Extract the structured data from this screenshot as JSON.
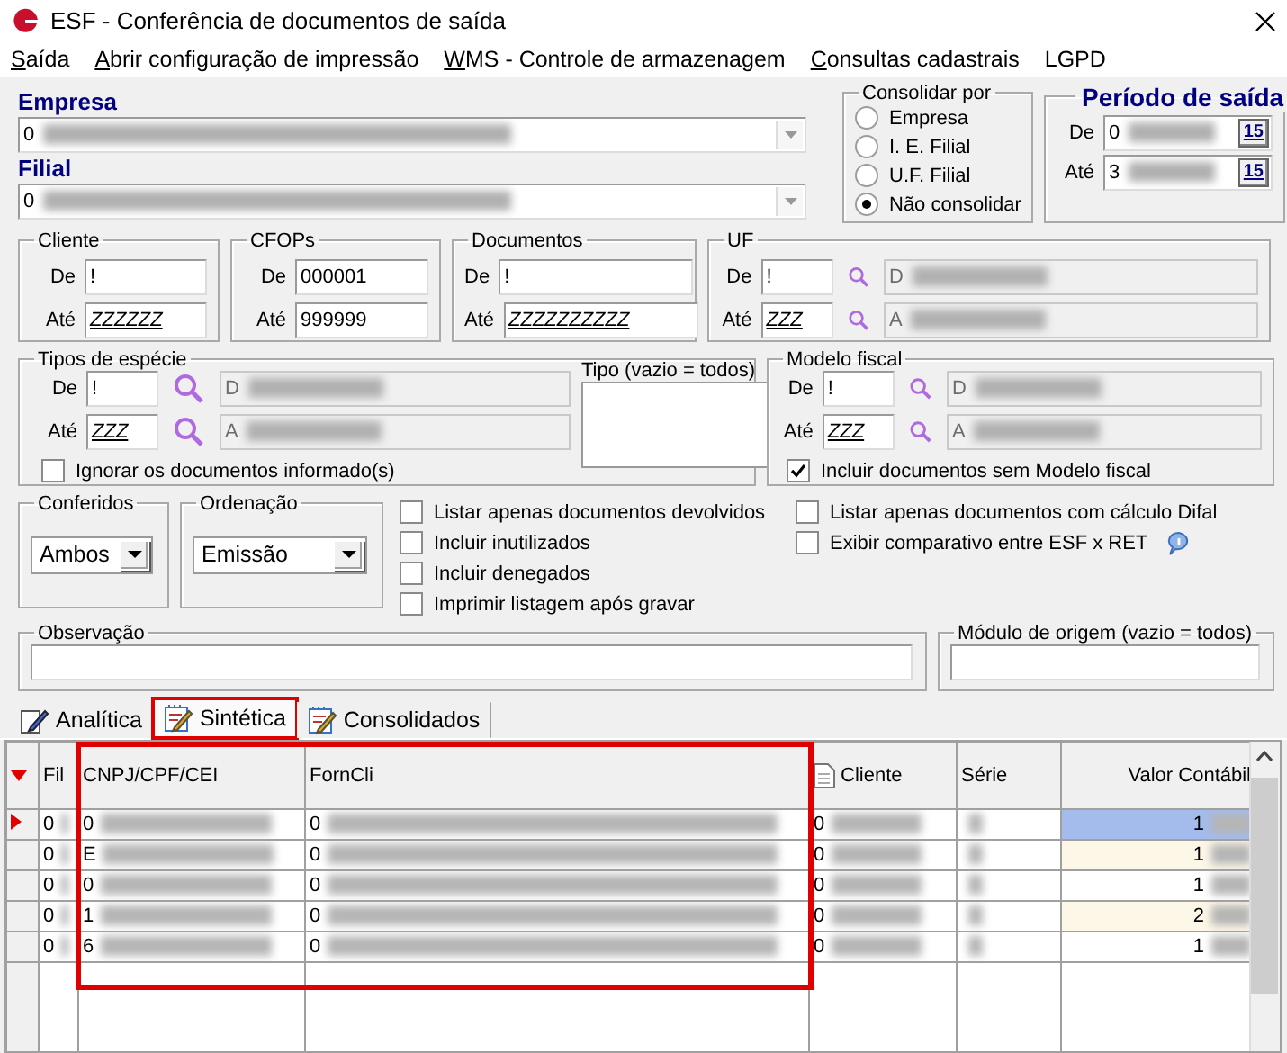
{
  "window": {
    "title": "ESF - Conferência de documentos de saída"
  },
  "menu": [
    {
      "key": "S",
      "rest": "aída"
    },
    {
      "key": "A",
      "rest": "brir configuração de impressão"
    },
    {
      "key": "W",
      "rest": "MS - Controle de armazenagem"
    },
    {
      "key": "C",
      "rest": "onsultas cadastrais"
    },
    {
      "label": "LGPD"
    }
  ],
  "empresa": {
    "label": "Empresa",
    "value": "0",
    "redacted": true
  },
  "filial": {
    "label": "Filial",
    "value": "0",
    "redacted": true
  },
  "consolidar": {
    "title": "Consolidar por",
    "options": [
      {
        "label": "Empresa",
        "selected": false
      },
      {
        "label": "I. E. Filial",
        "selected": false
      },
      {
        "label": "U.F. Filial",
        "selected": false
      },
      {
        "label": "Não consolidar",
        "selected": true
      }
    ]
  },
  "periodo": {
    "title": "Período de saída",
    "from": {
      "label": "De",
      "value": "0",
      "redacted": true,
      "button": "15"
    },
    "to": {
      "label": "Até",
      "value": "3",
      "redacted": true,
      "button": "15"
    }
  },
  "ranges": [
    {
      "title": "Cliente",
      "from": {
        "label": "De",
        "value": "!"
      },
      "to": {
        "label": "Até",
        "value": "ZZZZZZ"
      }
    },
    {
      "title": "CFOPs",
      "from": {
        "label": "De",
        "value": "000001"
      },
      "to": {
        "label": "Até",
        "value": "999999"
      }
    },
    {
      "title": "Documentos",
      "from": {
        "label": "De",
        "value": "!"
      },
      "to": {
        "label": "Até",
        "value": "ZZZZZZZZZZ"
      }
    }
  ],
  "uf": {
    "title": "UF",
    "from": {
      "label": "De",
      "value": "!",
      "desc": "D",
      "redacted": true
    },
    "to": {
      "label": "Até",
      "value": "ZZZ",
      "desc": "A",
      "redacted": true
    }
  },
  "tipos_especie": {
    "title": "Tipos de espécie",
    "from": {
      "label": "De",
      "value": "!",
      "desc": "D",
      "redacted": true
    },
    "to": {
      "label": "Até",
      "value": "ZZZ",
      "desc": "A",
      "redacted": true
    },
    "ignore": {
      "label": "Ignorar os documentos informado(s)",
      "checked": false
    },
    "tipo": {
      "label": "Tipo (vazio = todos)"
    }
  },
  "modelo_fiscal": {
    "title": "Modelo fiscal",
    "from": {
      "label": "De",
      "value": "!",
      "desc": "D",
      "redacted": true
    },
    "to": {
      "label": "Até",
      "value": "ZZZ",
      "desc": "A",
      "redacted": true
    },
    "include": {
      "label": "Incluir documentos sem Modelo fiscal",
      "checked": true
    }
  },
  "conferidos": {
    "title": "Conferidos",
    "value": "Ambos"
  },
  "ordenacao": {
    "title": "Ordenação",
    "value": "Emissão"
  },
  "options_left": [
    {
      "label": "Listar apenas documentos devolvidos",
      "checked": false
    },
    {
      "label": "Incluir inutilizados",
      "checked": false
    },
    {
      "label": "Incluir denegados",
      "checked": false
    },
    {
      "label": "Imprimir listagem após gravar",
      "checked": false
    }
  ],
  "options_right": [
    {
      "label": "Listar apenas documentos com cálculo Difal",
      "checked": false
    },
    {
      "label": "Exibir comparativo entre ESF x  RET",
      "checked": false,
      "info": true
    }
  ],
  "observacao": {
    "title": "Observação"
  },
  "modulo": {
    "title": "Módulo de origem (vazio = todos)"
  },
  "tabs": [
    {
      "label": "Analítica",
      "selected": false,
      "highlighted": false
    },
    {
      "label": "Sintética",
      "selected": true,
      "highlighted": true
    },
    {
      "label": "Consolidados",
      "selected": false,
      "highlighted": false
    }
  ],
  "grid": {
    "columns": [
      {
        "label": "Fil",
        "highlighted": false
      },
      {
        "label": "CNPJ/CPF/CEI",
        "highlighted": true
      },
      {
        "label": "FornCli",
        "highlighted": true
      },
      {
        "label": "Cliente",
        "highlighted": false,
        "icon": true
      },
      {
        "label": "Série",
        "highlighted": false
      },
      {
        "label": "Valor Contábil",
        "highlighted": false
      }
    ],
    "rows": [
      {
        "selected": true,
        "fil": "0",
        "cnpj": "0",
        "forncli": "0",
        "cliente": "0",
        "valor": "1",
        "redacted": true
      },
      {
        "selected": false,
        "fil": "0",
        "cnpj": "E",
        "forncli": "0",
        "cliente": "0",
        "valor": "1",
        "redacted": true
      },
      {
        "selected": false,
        "fil": "0",
        "cnpj": "0",
        "forncli": "0",
        "cliente": "0",
        "valor": "1",
        "redacted": true
      },
      {
        "selected": false,
        "fil": "0",
        "cnpj": "1",
        "forncli": "0",
        "cliente": "0",
        "valor": "2",
        "redacted": true
      },
      {
        "selected": false,
        "fil": "0",
        "cnpj": "6",
        "forncli": "0",
        "cliente": "0",
        "valor": "1",
        "redacted": true
      }
    ]
  }
}
